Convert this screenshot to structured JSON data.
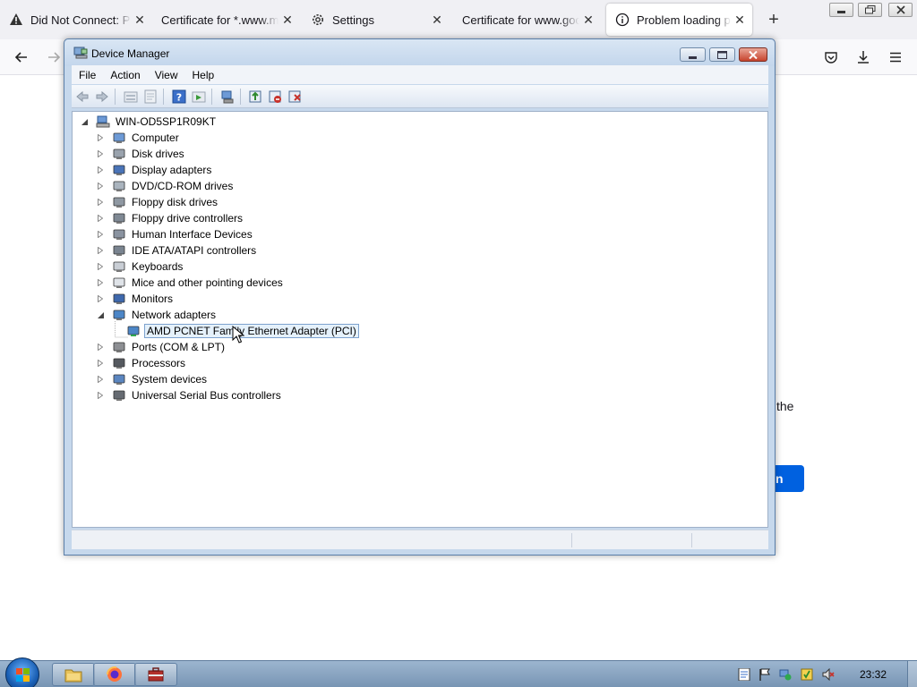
{
  "browser": {
    "tabs": [
      {
        "title": "Did Not Connect: Potential Security Issue",
        "icon": "warning-icon",
        "active": false
      },
      {
        "title": "Certificate for *.www.mozilla.org",
        "icon": "none",
        "active": false
      },
      {
        "title": "Settings",
        "icon": "gear-icon",
        "active": false
      },
      {
        "title": "Certificate for www.google.com",
        "icon": "none",
        "active": false
      },
      {
        "title": "Problem loading page",
        "icon": "info-icon",
        "active": true
      }
    ],
    "close_glyph": "✕",
    "new_tab_glyph": "+",
    "page_snippet_text": "the",
    "page_button_text": "n"
  },
  "device_manager": {
    "title": "Device Manager",
    "menu": [
      "File",
      "Action",
      "View",
      "Help"
    ],
    "computer_name": "WIN-OD5SP1R09KT",
    "categories": [
      {
        "label": "Computer",
        "icon": "computer-icon",
        "expanded": false
      },
      {
        "label": "Disk drives",
        "icon": "disk-drive-icon",
        "expanded": false
      },
      {
        "label": "Display adapters",
        "icon": "display-adapter-icon",
        "expanded": false
      },
      {
        "label": "DVD/CD-ROM drives",
        "icon": "dvd-drive-icon",
        "expanded": false
      },
      {
        "label": "Floppy disk drives",
        "icon": "floppy-disk-icon",
        "expanded": false
      },
      {
        "label": "Floppy drive controllers",
        "icon": "floppy-controller-icon",
        "expanded": false
      },
      {
        "label": "Human Interface Devices",
        "icon": "hid-icon",
        "expanded": false
      },
      {
        "label": "IDE ATA/ATAPI controllers",
        "icon": "ide-controller-icon",
        "expanded": false
      },
      {
        "label": "Keyboards",
        "icon": "keyboard-icon",
        "expanded": false
      },
      {
        "label": "Mice and other pointing devices",
        "icon": "mouse-icon",
        "expanded": false
      },
      {
        "label": "Monitors",
        "icon": "monitor-icon",
        "expanded": false
      },
      {
        "label": "Network adapters",
        "icon": "network-adapter-icon",
        "expanded": true,
        "children": [
          {
            "label": "AMD PCNET Family Ethernet Adapter (PCI)",
            "icon": "network-adapter-icon",
            "selected": true
          }
        ]
      },
      {
        "label": "Ports (COM & LPT)",
        "icon": "port-icon",
        "expanded": false
      },
      {
        "label": "Processors",
        "icon": "processor-icon",
        "expanded": false
      },
      {
        "label": "System devices",
        "icon": "system-device-icon",
        "expanded": false
      },
      {
        "label": "Universal Serial Bus controllers",
        "icon": "usb-icon",
        "expanded": false
      }
    ]
  },
  "taskbar": {
    "clock": "23:32",
    "apps": [
      "explorer-icon",
      "firefox-icon",
      "toolbox-icon"
    ]
  },
  "colors": {
    "accent": "#0061e0",
    "window_frame": "#c6d8ec",
    "selection": "#e5f1fb"
  }
}
